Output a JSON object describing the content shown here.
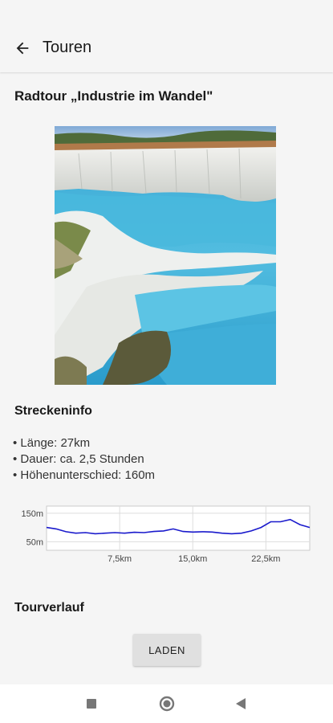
{
  "appbar": {
    "title": "Touren",
    "back_icon": "arrow-left-icon"
  },
  "tour": {
    "title": "Radtour „Industrie im Wandel\"",
    "image_alt": "quarry-lake-photo"
  },
  "route_info": {
    "heading": "Streckeninfo",
    "items": [
      "• Länge: 27km",
      "• Dauer: ca. 2,5 Stunden",
      "• Höhenunterschied: 160m"
    ]
  },
  "elevation": {
    "y_ticks": [
      "150m",
      "50m"
    ],
    "x_ticks": [
      "7,5km",
      "15,0km",
      "22,5km"
    ],
    "line_color": "#1a1acc",
    "grid_color": "#dddddd"
  },
  "chart_data": {
    "type": "line",
    "title": "",
    "xlabel": "",
    "ylabel": "",
    "x": [
      0,
      1,
      2,
      3,
      4,
      5,
      6,
      7,
      8,
      9,
      10,
      11,
      12,
      13,
      14,
      15,
      16,
      17,
      18,
      19,
      20,
      21,
      22,
      23,
      24,
      25,
      26,
      27
    ],
    "y": [
      100,
      95,
      85,
      80,
      82,
      78,
      80,
      82,
      80,
      83,
      82,
      86,
      88,
      95,
      86,
      84,
      85,
      84,
      80,
      78,
      80,
      88,
      100,
      120,
      120,
      128,
      110,
      100
    ],
    "xlim": [
      0,
      27
    ],
    "ylim": [
      20,
      175
    ],
    "x_tick_values": [
      7.5,
      15.0,
      22.5
    ],
    "y_tick_values": [
      150,
      50
    ],
    "grid": true
  },
  "tour_route": {
    "heading": "Tourverlauf",
    "load_label": "LADEN"
  },
  "navbar": {
    "recent_icon": "square-icon",
    "home_icon": "circle-icon",
    "back_icon": "triangle-back-icon"
  }
}
